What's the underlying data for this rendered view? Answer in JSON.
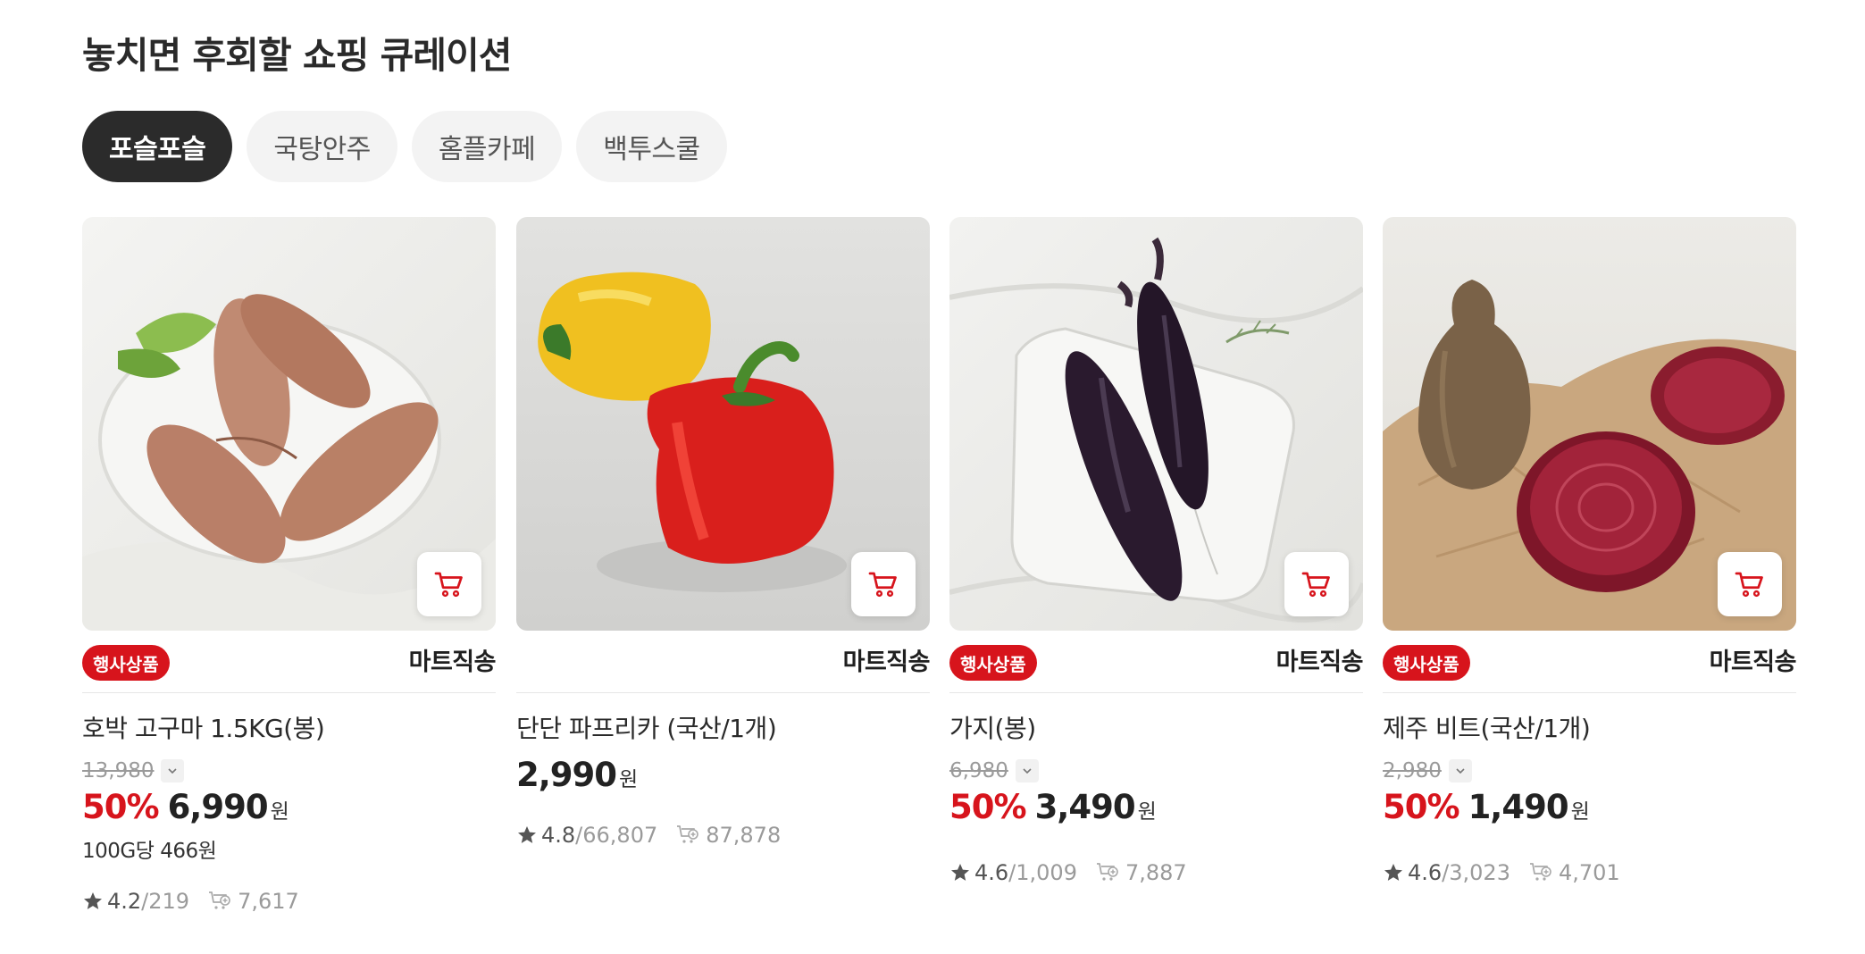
{
  "section": {
    "title": "놓치면 후회할 쇼핑 큐레이션"
  },
  "tabs": [
    {
      "label": "포슬포슬",
      "active": true
    },
    {
      "label": "국탕안주",
      "active": false
    },
    {
      "label": "홈플카페",
      "active": false
    },
    {
      "label": "백투스쿨",
      "active": false
    }
  ],
  "products": [
    {
      "image": "sweet-potatoes-on-plate",
      "badge": "행사상품",
      "delivery": "마트직송",
      "name": "호박 고구마 1.5KG(봉)",
      "original_price": "13,980",
      "discount": "50%",
      "price": "6,990",
      "currency": "원",
      "unit_price": "100G당 466원",
      "rating": "4.2",
      "reviews": "/219",
      "cart_count": "7,617"
    },
    {
      "image": "yellow-and-red-paprika",
      "badge": "",
      "delivery": "마트직송",
      "name": "단단 파프리카 (국산/1개)",
      "original_price": "",
      "discount": "",
      "price": "2,990",
      "currency": "원",
      "unit_price": "",
      "rating": "4.8",
      "reviews": "/66,807",
      "cart_count": "87,878"
    },
    {
      "image": "eggplants-on-plate",
      "badge": "행사상품",
      "delivery": "마트직송",
      "name": "가지(봉)",
      "original_price": "6,980",
      "discount": "50%",
      "price": "3,490",
      "currency": "원",
      "unit_price": "",
      "rating": "4.6",
      "reviews": "/1,009",
      "cart_count": "7,887"
    },
    {
      "image": "beetroots-on-paper",
      "badge": "행사상품",
      "delivery": "마트직송",
      "name": "제주 비트(국산/1개)",
      "original_price": "2,980",
      "discount": "50%",
      "price": "1,490",
      "currency": "원",
      "unit_price": "",
      "rating": "4.6",
      "reviews": "/3,023",
      "cart_count": "4,701"
    }
  ],
  "colors": {
    "accent": "#d7141c",
    "tab_active": "#2b2b2b",
    "tab_inactive": "#f3f3f3"
  },
  "icons": {
    "cart_button": "cart-icon",
    "rating": "star-icon",
    "cart_count": "cart-plus-icon",
    "expand": "chevron-down-icon"
  }
}
